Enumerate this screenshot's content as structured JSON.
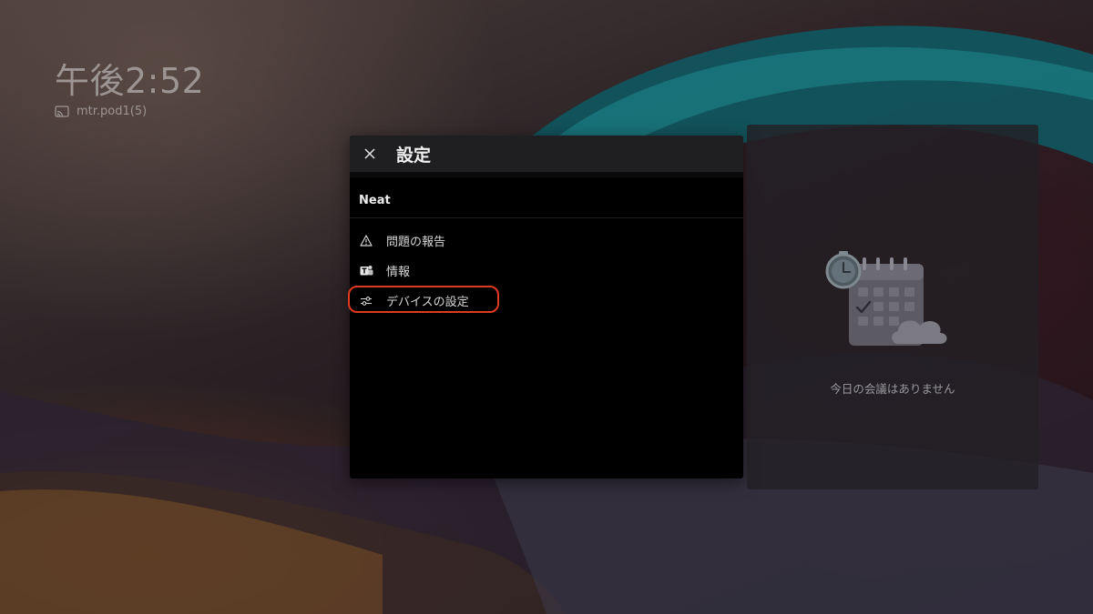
{
  "status": {
    "time": "午後2:52",
    "room_name": "mtr.pod1(5)"
  },
  "settings": {
    "title": "設定",
    "section": "Neat",
    "items": [
      {
        "label": "問題の報告",
        "icon": "warning-icon"
      },
      {
        "label": "情報",
        "icon": "teams-icon"
      },
      {
        "label": "デバイスの設定",
        "icon": "sliders-icon",
        "highlighted": true
      }
    ]
  },
  "calendar": {
    "empty_message": "今日の会議はありません"
  },
  "colors": {
    "highlight": "#e03a1e",
    "panel_bg": "#000000",
    "header_bg": "#1f1f21"
  }
}
